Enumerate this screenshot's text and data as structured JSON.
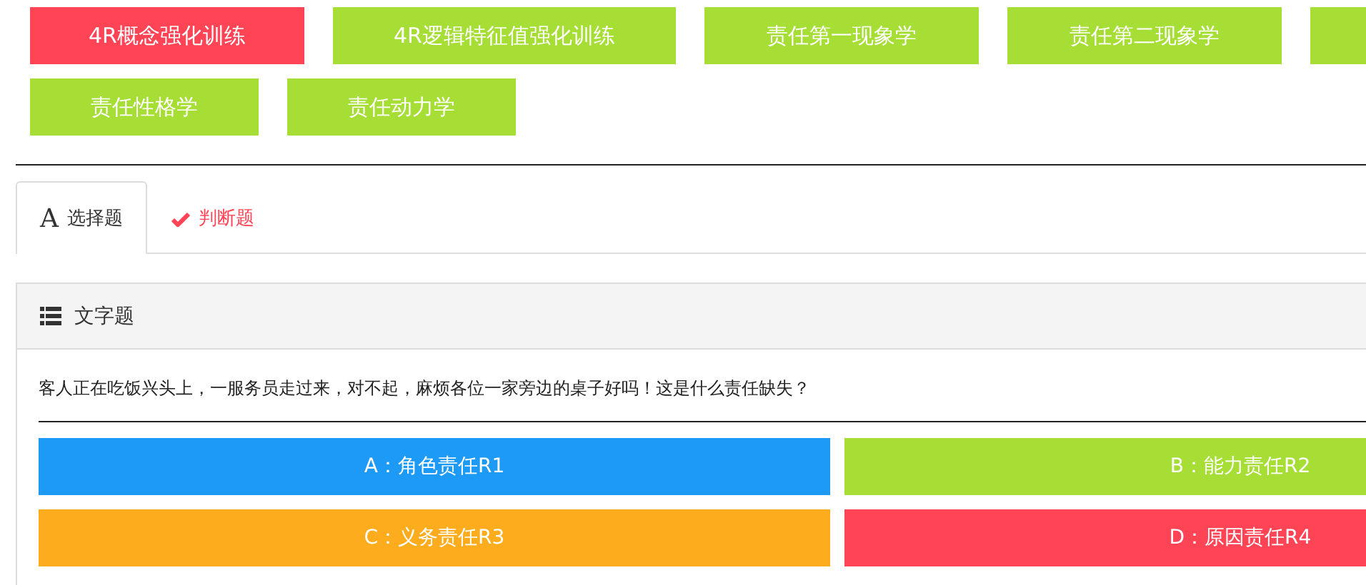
{
  "categories": [
    {
      "label": "4R概念强化训练",
      "selected": true
    },
    {
      "label": "4R逻辑特征值强化训练",
      "selected": false
    },
    {
      "label": "责任第一现象学",
      "selected": false
    },
    {
      "label": "责任第二现象学",
      "selected": false
    },
    {
      "selected": false
    },
    {
      "label": "责任性格学",
      "selected": false
    },
    {
      "label": "责任动力学",
      "selected": false
    }
  ],
  "tabs": [
    {
      "kind": "letter",
      "icon": "A",
      "label": "选择题",
      "selected": true
    },
    {
      "kind": "check",
      "label": "判断题",
      "selected": false
    }
  ],
  "panel": {
    "title": "文字题",
    "question": "客人正在吃饭兴头上，一服务员走过来，对不起，麻烦各位一家旁边的桌子好吗！这是什么责任缺失？",
    "options": [
      {
        "label": "A：角色责任R1",
        "color": "#1c9af5"
      },
      {
        "label": "B：能力责任R2",
        "color": "#a6de36"
      },
      {
        "label": "C：义务责任R3",
        "color": "#fcac1c"
      },
      {
        "label": "D：原因责任R4",
        "color": "#ff4455"
      }
    ]
  }
}
